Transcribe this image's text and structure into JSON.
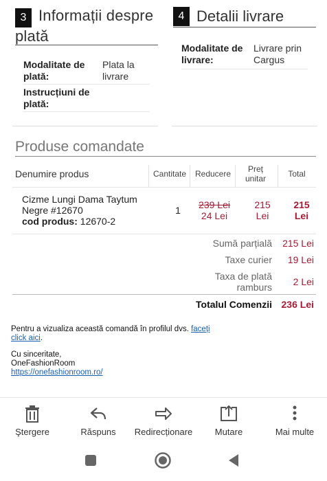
{
  "payment_section": {
    "number": "3",
    "title": "Informații despre plată"
  },
  "delivery_section": {
    "number": "4",
    "title": "Detalii livrare"
  },
  "payment": {
    "method_label": "Modalitate de plată:",
    "method_value": "Plata la livrare",
    "instructions_label": "Instrucțiuni de plată:",
    "instructions_value": ""
  },
  "delivery": {
    "method_label": "Modalitate de livrare:",
    "method_value": "Livrare prin Cargus"
  },
  "products": {
    "title": "Produse comandate",
    "headers": {
      "name": "Denumire produs",
      "qty": "Cantitate",
      "discount": "Reducere",
      "unit_price": "Preț unitar",
      "total": "Total"
    },
    "items": [
      {
        "name": "Cizme Lungi Dama Taytum Negre #12670",
        "code_label": "cod produs:",
        "code": "12670-2",
        "qty": "1",
        "old_price": "239 Lei",
        "discount": "24 Lei",
        "unit_price": "215 Lei",
        "total": "215 Lei"
      }
    ]
  },
  "summary": {
    "subtotal_label": "Sumă parțială",
    "subtotal_value": "215 Lei",
    "courier_label": "Taxe curier",
    "courier_value": "19 Lei",
    "cod_fee_label": "Taxa de plată ramburs",
    "cod_fee_value": "2 Lei",
    "total_label": "Totalul Comenzii",
    "total_value": "236 Lei"
  },
  "footer": {
    "view_text": "Pentru a vizualiza această comandă în profilul dvs.",
    "view_link": "faceți click aici",
    "signoff": "Cu sinceritate,",
    "company": "OneFashionRoom",
    "url": "https://onefashionroom.ro/"
  },
  "actions": {
    "delete": "Ştergere",
    "reply": "Răspuns",
    "forward": "Redirecționare",
    "move": "Mutare",
    "more": "Mai multe"
  },
  "colors": {
    "accent_red": "#a61b34",
    "link_blue": "#1a5fb4"
  }
}
